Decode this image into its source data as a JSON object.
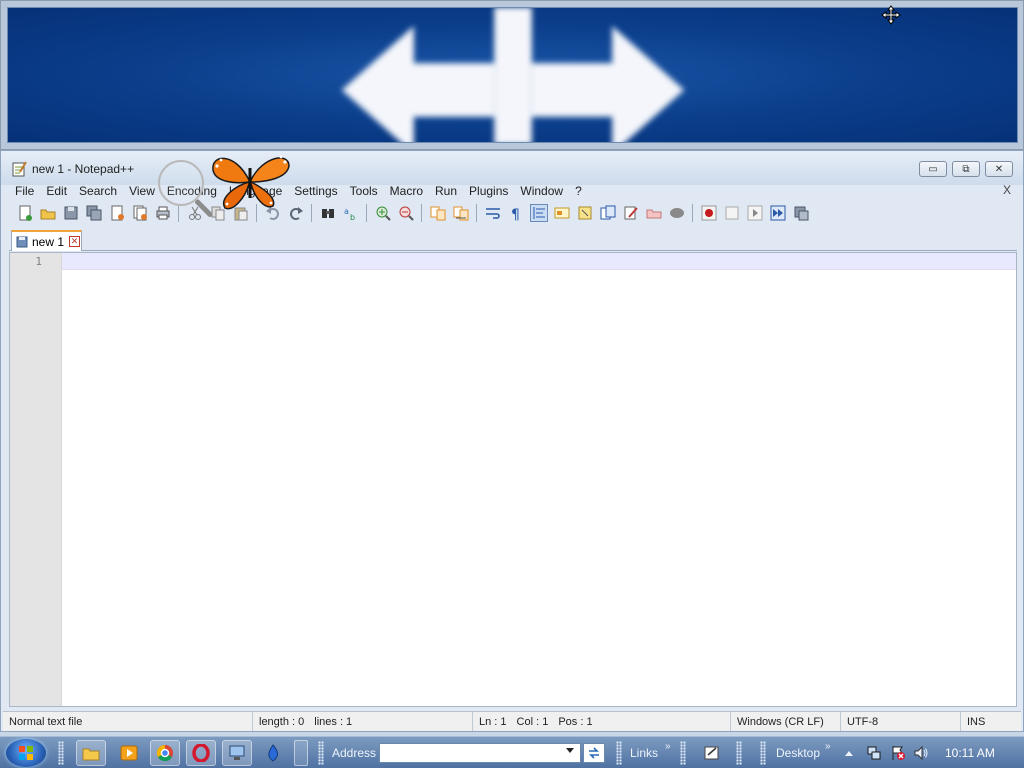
{
  "window": {
    "title": "new 1 - Notepad++",
    "min_glyph": "▭",
    "max_glyph": "⧉",
    "close_glyph": "✕"
  },
  "menu": {
    "items": [
      "File",
      "Edit",
      "Search",
      "View",
      "Encoding",
      "Language",
      "Settings",
      "Tools",
      "Macro",
      "Run",
      "Plugins",
      "Window",
      "?"
    ],
    "close_doc": "X"
  },
  "tab": {
    "label": "new 1",
    "close_glyph": "✕"
  },
  "editor": {
    "line_number": "1"
  },
  "status": {
    "doc_type": "Normal text file",
    "length": "length : 0",
    "lines": "lines : 1",
    "ln": "Ln : 1",
    "col": "Col : 1",
    "pos": "Pos : 1",
    "eol": "Windows (CR LF)",
    "encoding": "UTF-8",
    "mode": "INS"
  },
  "taskbar": {
    "address_label": "Address",
    "links_label": "Links",
    "desktop_label": "Desktop",
    "chevron": "»",
    "clock": "10:11 AM"
  },
  "colors": {
    "magnifier_bg": "#0a3d8a",
    "tab_accent": "#f2a23a",
    "current_line": "#e8e8ff",
    "taskbar": "#4f72a3"
  }
}
